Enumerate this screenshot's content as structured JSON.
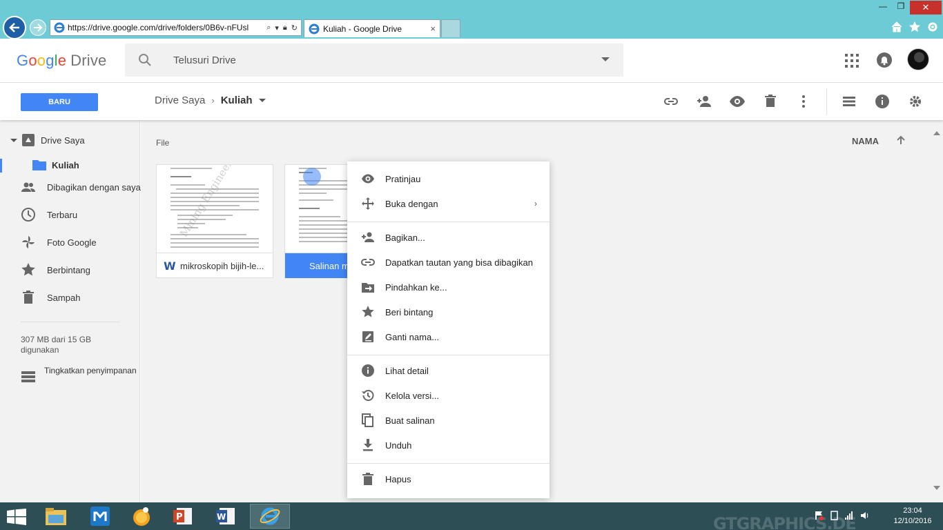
{
  "browser": {
    "url": "https://drive.google.com/drive/folders/0B6v-nFUsl",
    "tab_title": "Kuliah - Google Drive",
    "tab_close": "×",
    "win_min": "—",
    "win_max": "❐",
    "win_close": "✕"
  },
  "header": {
    "logo_letters": [
      "G",
      "o",
      "o",
      "g",
      "l",
      "e"
    ],
    "product_name": "Drive",
    "search_placeholder": "Telusuri Drive"
  },
  "toolbar": {
    "new_button": "BARU",
    "breadcrumb_root": "Drive Saya",
    "breadcrumb_sep": "›",
    "breadcrumb_current": "Kuliah"
  },
  "sidebar": {
    "items": [
      {
        "label": "Drive Saya",
        "icon": "drive-icon"
      },
      {
        "label": "Kuliah",
        "icon": "folder-icon"
      },
      {
        "label": "Dibagikan dengan saya",
        "icon": "people-icon"
      },
      {
        "label": "Terbaru",
        "icon": "clock-icon"
      },
      {
        "label": "Foto Google",
        "icon": "pinwheel-icon"
      },
      {
        "label": "Berbintang",
        "icon": "star-icon"
      },
      {
        "label": "Sampah",
        "icon": "trash-icon"
      }
    ],
    "storage": "307 MB dari 15 GB digunakan",
    "upgrade": "Tingkatkan penyimpanan"
  },
  "main": {
    "section_label": "File",
    "sort_label": "NAMA",
    "files": [
      {
        "name": "mikroskopih bijih-le...",
        "type_icon": "W"
      },
      {
        "name": "Salinan m"
      }
    ]
  },
  "context_menu": {
    "items": [
      {
        "label": "Pratinjau",
        "icon": "eye-icon"
      },
      {
        "label": "Buka dengan",
        "icon": "move-icon",
        "arrow": "›"
      },
      {
        "label": "Bagikan...",
        "icon": "person-add-icon"
      },
      {
        "label": "Dapatkan tautan yang bisa dibagikan",
        "icon": "link-icon"
      },
      {
        "label": "Pindahkan ke...",
        "icon": "move-to-icon"
      },
      {
        "label": "Beri bintang",
        "icon": "star-icon"
      },
      {
        "label": "Ganti nama...",
        "icon": "edit-icon"
      },
      {
        "label": "Lihat detail",
        "icon": "info-icon"
      },
      {
        "label": "Kelola versi...",
        "icon": "history-icon"
      },
      {
        "label": "Buat salinan",
        "icon": "copy-icon"
      },
      {
        "label": "Unduh",
        "icon": "download-icon"
      },
      {
        "label": "Hapus",
        "icon": "trash-icon"
      }
    ]
  },
  "taskbar": {
    "time": "23:04",
    "date": "12/10/2016",
    "brand": "GTGRAPHICS.DE"
  },
  "colors": {
    "accent": "#4285f4",
    "browser_frame": "#6ccbd4",
    "taskbar": "#2d4e55"
  }
}
